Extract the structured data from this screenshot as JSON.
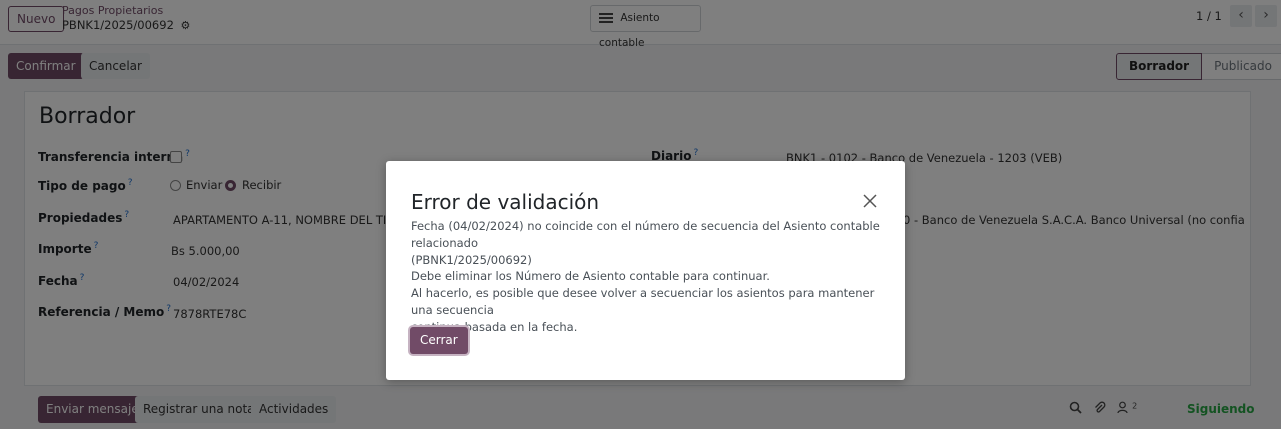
{
  "topbar": {
    "new_label": "Nuevo",
    "breadcrumb": "Pagos Propietarios",
    "record_ref": "PBNK1/2025/00692",
    "smart_button": "Asiento contable",
    "pager": "1 / 1"
  },
  "control_panel": {
    "confirm_label": "Confirmar",
    "cancel_label": "Cancelar",
    "status": {
      "active": "Borrador",
      "next": "Publicado"
    }
  },
  "form": {
    "title": "Borrador",
    "fields": {
      "internal_transfer": {
        "label": "Transferencia interna",
        "tip": "?"
      },
      "payment_type": {
        "label": "Tipo de pago",
        "tip": "?",
        "options": [
          "Enviar",
          "Recibir"
        ],
        "selected": "Recibir"
      },
      "properties": {
        "label": "Propiedades",
        "tip": "?",
        "value": "APARTAMENTO A-11, NOMBRE DEL TITULA"
      },
      "amount": {
        "label": "Importe",
        "tip": "?",
        "value": "Bs 5.000,00"
      },
      "date": {
        "label": "Fecha",
        "tip": "?",
        "value": "04/02/2024"
      },
      "memo": {
        "label": "Referencia / Memo",
        "tip": "?",
        "value": "7878RTE78C"
      },
      "journal": {
        "label": "Diario",
        "tip": "?",
        "value": "BNK1 - 0102 - Banco de Venezuela - 1203 (VEB)"
      },
      "bank_account_partial": "0 - Banco de Venezuela S.A.C.A. Banco Universal (no confia"
    }
  },
  "chatter": {
    "send_message": "Enviar mensaje",
    "log_note": "Registrar una nota",
    "activities": "Actividades",
    "followers_count": "2",
    "following": "Siguiendo"
  },
  "modal": {
    "title": "Error de validación",
    "lines": [
      "Fecha (04/02/2024) no coincide con el número de secuencia del Asiento contable relacionado",
      "(PBNK1/2025/00692)",
      "Debe eliminar los Número de Asiento contable para continuar.",
      "Al hacerlo, es posible que desee volver a secuenciar los asientos para mantener una secuencia",
      "continua basada en la fecha."
    ],
    "close_label": "Cerrar"
  }
}
